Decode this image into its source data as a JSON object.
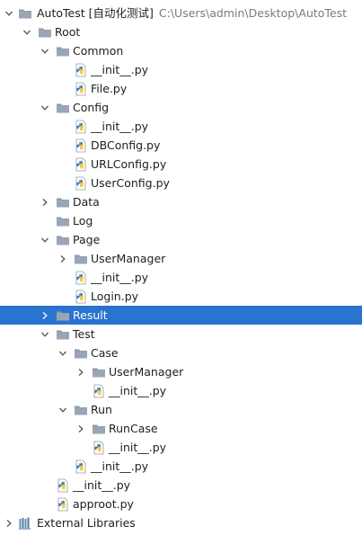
{
  "project": {
    "name": "AutoTest",
    "module_tag": "[自动化测试]",
    "path": "C:\\Users\\admin\\Desktop\\AutoTest"
  },
  "tree": {
    "root": "Root",
    "common": "Common",
    "common_init": "__init__.py",
    "common_file": "File.py",
    "config": "Config",
    "config_init": "__init__.py",
    "config_db": "DBConfig.py",
    "config_url": "URLConfig.py",
    "config_user": "UserConfig.py",
    "data": "Data",
    "log": "Log",
    "page": "Page",
    "page_usermanager": "UserManager",
    "page_init": "__init__.py",
    "page_login": "Login.py",
    "result": "Result",
    "test": "Test",
    "case": "Case",
    "case_usermanager": "UserManager",
    "case_init": "__init__.py",
    "run": "Run",
    "run_runcase": "RunCase",
    "run_init": "__init__.py",
    "test_init": "__init__.py",
    "root_init": "__init__.py",
    "approot": "approot.py",
    "external_libraries": "External Libraries"
  },
  "colors": {
    "selection": "#2a74d0",
    "folder": "#8c99a8",
    "path_text": "#7a7a7a",
    "python_blue": "#3d77b5",
    "python_yellow": "#f3c83a"
  },
  "icons": {
    "folder": "folder-icon",
    "python_file": "python-file-icon",
    "expanded": "chevron-down-icon",
    "collapsed": "chevron-right-icon",
    "libraries": "libraries-icon"
  }
}
